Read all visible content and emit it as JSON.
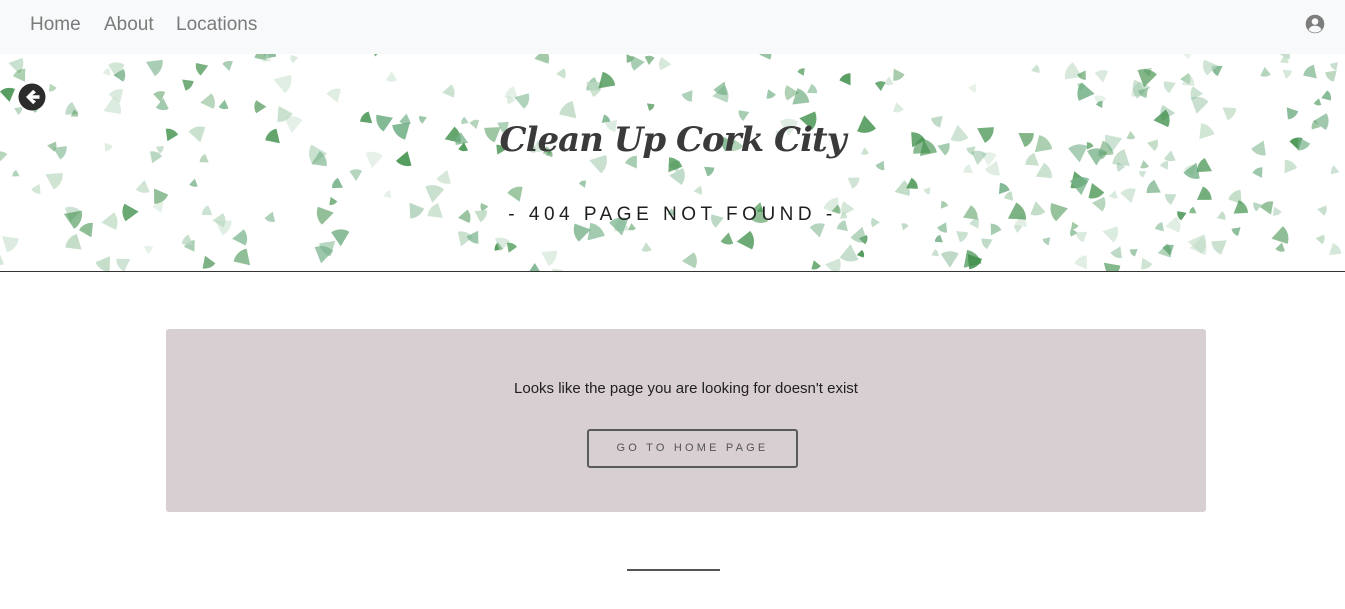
{
  "nav": {
    "links": [
      {
        "label": "Home"
      },
      {
        "label": "About"
      },
      {
        "label": "Locations"
      }
    ],
    "account_icon": "user-circle-icon"
  },
  "hero": {
    "back_icon": "arrow-circle-left-icon",
    "title": "Clean Up Cork City",
    "subtitle": "- 404 PAGE NOT FOUND -",
    "background": "leaf-confetti-pattern"
  },
  "error": {
    "message": "Looks like the page you are looking for doesn't exist",
    "button_label": "GO TO HOME PAGE"
  },
  "colors": {
    "navbar_bg": "#f8f9fa",
    "nav_link": "#7a7a7a",
    "card_bg": "#d7cfd1",
    "leaf_dark": "#3f8f4a",
    "leaf_mid": "#74b087",
    "leaf_light": "#bcd9c2"
  }
}
